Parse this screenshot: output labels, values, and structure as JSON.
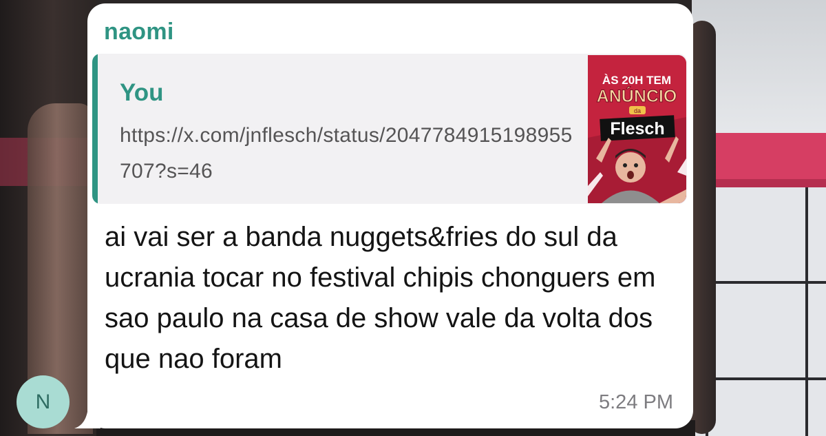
{
  "message": {
    "sender": "naomi",
    "reply": {
      "author": "You",
      "link_text": "https://x.com/jnflesch/status/2047784915198955707?s=46",
      "thumbnail": {
        "line1": "ÀS 20H TEM",
        "line2": "ANÚNCIO",
        "line3": "da",
        "line4": "Flesch"
      }
    },
    "text": "ai vai ser a banda nuggets&fries do sul da ucrania tocar no festival chipis chonguers em sao paulo na casa de show vale da volta dos que nao foram",
    "time": "5:24 PM"
  },
  "avatar": {
    "initial": "N"
  },
  "colors": {
    "accent": "#2f9483",
    "bubble": "#ffffff",
    "quote_bg": "#f2f1f3",
    "avatar_bg": "#a9dcd3",
    "thumb_red": "#c4233e"
  }
}
